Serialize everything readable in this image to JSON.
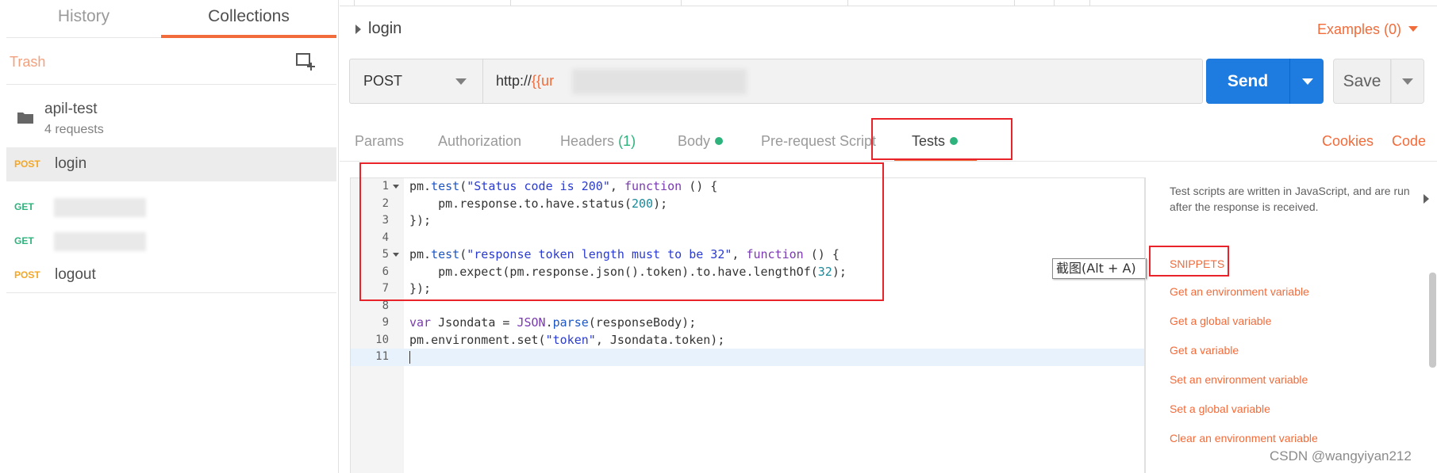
{
  "sidebar": {
    "tabs": [
      {
        "label": "History",
        "active": false
      },
      {
        "label": "Collections",
        "active": true
      }
    ],
    "trash_label": "Trash",
    "new_collection_icon": "new-collection-icon",
    "collection": {
      "name": "apil-test",
      "count": "4 requests",
      "icon": "folder-icon"
    },
    "requests": [
      {
        "method": "POST",
        "name": "login",
        "active": true
      },
      {
        "method": "GET",
        "name": "",
        "redacted": true
      },
      {
        "method": "GET",
        "name": "",
        "redacted": true
      },
      {
        "method": "POST",
        "name": "logout"
      }
    ]
  },
  "request": {
    "name": "login",
    "examples_label": "Examples (0)",
    "method": "POST",
    "url_prefix": "http://",
    "url_variable": "{{ur",
    "send_label": "Send",
    "save_label": "Save",
    "tabs": {
      "params": "Params",
      "authorization": "Authorization",
      "headers": "Headers",
      "headers_count": "(1)",
      "body": "Body",
      "prerequest": "Pre-request Script",
      "tests": "Tests"
    },
    "active_tab": "Tests",
    "cookies_label": "Cookies",
    "code_label": "Code"
  },
  "editor": {
    "line_numbers": [
      "1",
      "2",
      "3",
      "4",
      "5",
      "6",
      "7",
      "8",
      "9",
      "10",
      "11"
    ],
    "current_line": "11",
    "tooltip": "截图(Alt + A)"
  },
  "snippets": {
    "description": "Test scripts are written in JavaScript, and are run after the response is received.",
    "heading": "SNIPPETS",
    "items": [
      "Get an environment variable",
      "Get a global variable",
      "Get a variable",
      "Set an environment variable",
      "Set a global variable",
      "Clear an environment variable"
    ]
  },
  "watermark": "CSDN @wangyiyan212",
  "colors": {
    "accent": "#f26b3a",
    "send": "#1e7be0",
    "green": "#2eb37c",
    "annotation": "#e8232a"
  }
}
